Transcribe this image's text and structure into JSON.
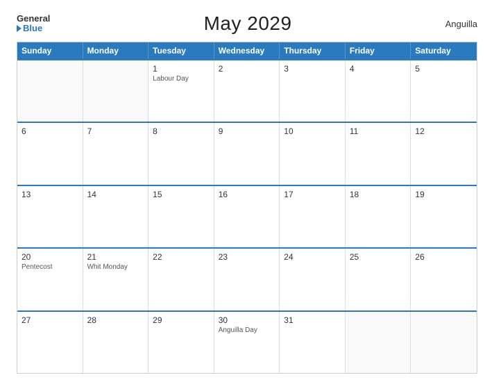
{
  "header": {
    "logo_general": "General",
    "logo_blue": "Blue",
    "title": "May 2029",
    "region": "Anguilla"
  },
  "days_of_week": [
    "Sunday",
    "Monday",
    "Tuesday",
    "Wednesday",
    "Thursday",
    "Friday",
    "Saturday"
  ],
  "weeks": [
    [
      {
        "day": "",
        "holiday": "",
        "empty": true
      },
      {
        "day": "",
        "holiday": "",
        "empty": true
      },
      {
        "day": "1",
        "holiday": "Labour Day"
      },
      {
        "day": "2",
        "holiday": ""
      },
      {
        "day": "3",
        "holiday": ""
      },
      {
        "day": "4",
        "holiday": ""
      },
      {
        "day": "5",
        "holiday": ""
      }
    ],
    [
      {
        "day": "6",
        "holiday": ""
      },
      {
        "day": "7",
        "holiday": ""
      },
      {
        "day": "8",
        "holiday": ""
      },
      {
        "day": "9",
        "holiday": ""
      },
      {
        "day": "10",
        "holiday": ""
      },
      {
        "day": "11",
        "holiday": ""
      },
      {
        "day": "12",
        "holiday": ""
      }
    ],
    [
      {
        "day": "13",
        "holiday": ""
      },
      {
        "day": "14",
        "holiday": ""
      },
      {
        "day": "15",
        "holiday": ""
      },
      {
        "day": "16",
        "holiday": ""
      },
      {
        "day": "17",
        "holiday": ""
      },
      {
        "day": "18",
        "holiday": ""
      },
      {
        "day": "19",
        "holiday": ""
      }
    ],
    [
      {
        "day": "20",
        "holiday": "Pentecost"
      },
      {
        "day": "21",
        "holiday": "Whit Monday"
      },
      {
        "day": "22",
        "holiday": ""
      },
      {
        "day": "23",
        "holiday": ""
      },
      {
        "day": "24",
        "holiday": ""
      },
      {
        "day": "25",
        "holiday": ""
      },
      {
        "day": "26",
        "holiday": ""
      }
    ],
    [
      {
        "day": "27",
        "holiday": ""
      },
      {
        "day": "28",
        "holiday": ""
      },
      {
        "day": "29",
        "holiday": ""
      },
      {
        "day": "30",
        "holiday": "Anguilla Day"
      },
      {
        "day": "31",
        "holiday": ""
      },
      {
        "day": "",
        "holiday": "",
        "empty": true
      },
      {
        "day": "",
        "holiday": "",
        "empty": true
      }
    ]
  ]
}
